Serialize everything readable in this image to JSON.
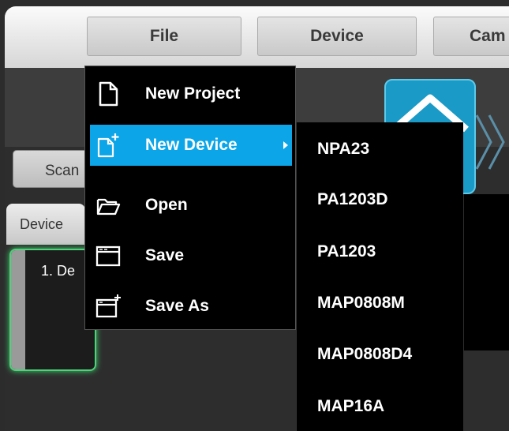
{
  "menubar": {
    "file_label": "File",
    "device_label": "Device",
    "camera_label": "Cam"
  },
  "toolbar": {
    "scan_label": "Scan"
  },
  "device_panel": {
    "tab_label": "Device",
    "item_label": "1. De"
  },
  "file_menu": {
    "items": [
      {
        "label": "New Project",
        "icon": "new-document-icon"
      },
      {
        "label": "New Device",
        "icon": "new-device-icon",
        "has_submenu": true,
        "highlighted": true
      },
      {
        "label": "Open",
        "icon": "folder-open-icon"
      },
      {
        "label": "Save",
        "icon": "save-window-icon"
      },
      {
        "label": "Save As",
        "icon": "save-as-window-icon"
      }
    ]
  },
  "new_device_submenu": {
    "items": [
      "NPA23",
      "PA1203D",
      "PA1203",
      "MAP0808M",
      "MAP0808D4",
      "MAP16A"
    ]
  },
  "colors": {
    "highlight": "#0ba5e8",
    "home_button": "#1a9ac6",
    "panel_border": "#4ed27a"
  }
}
